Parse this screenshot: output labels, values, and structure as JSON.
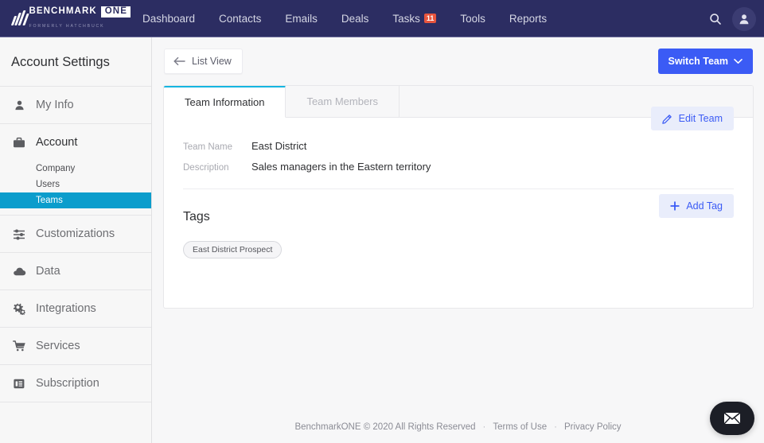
{
  "topnav": {
    "logo": {
      "brand": "BENCHMARK",
      "brand_mark": "ONE",
      "tagline": "FORMERLY HATCHBUCK",
      "icon": "benchmarkone-logo-icon"
    },
    "items": [
      {
        "label": "Dashboard"
      },
      {
        "label": "Contacts"
      },
      {
        "label": "Emails"
      },
      {
        "label": "Deals"
      },
      {
        "label": "Tasks",
        "badge": "11"
      },
      {
        "label": "Tools"
      },
      {
        "label": "Reports"
      }
    ],
    "search_icon": "search-icon",
    "account_icon": "user-account-icon",
    "bg_color": "#2c2d62",
    "badge_color": "#e8553e"
  },
  "sidebar": {
    "title": "Account Settings",
    "items": [
      {
        "label": "My Info",
        "icon": "person-icon"
      },
      {
        "label": "Account",
        "icon": "briefcase-icon"
      },
      {
        "label": "Customizations",
        "icon": "sliders-icon"
      },
      {
        "label": "Data",
        "icon": "cloud-icon"
      },
      {
        "label": "Integrations",
        "icon": "gears-icon"
      },
      {
        "label": "Services",
        "icon": "cart-icon"
      },
      {
        "label": "Subscription",
        "icon": "card-list-icon"
      }
    ],
    "account_subitems": [
      {
        "label": "Company",
        "active": false
      },
      {
        "label": "Users",
        "active": false
      },
      {
        "label": "Teams",
        "active": true
      }
    ],
    "active_color": "#0b9dcc"
  },
  "main": {
    "toolbar": {
      "list_view_label": "List View",
      "list_view_icon": "arrow-left-icon",
      "switch_team_label": "Switch Team",
      "switch_team_icon": "chevron-down-icon",
      "switch_team_color": "#3b5bf5"
    },
    "tabs": [
      {
        "label": "Team Information",
        "active": true
      },
      {
        "label": "Team Members",
        "active": false
      }
    ],
    "tab_accent_color": "#16b5e0",
    "fields": [
      {
        "label": "Team Name",
        "value": "East District"
      },
      {
        "label": "Description",
        "value": "Sales managers in the Eastern territory"
      }
    ],
    "edit_team": {
      "label": "Edit Team",
      "icon": "pencil-icon"
    },
    "tags_section": {
      "title": "Tags",
      "add_tag": {
        "label": "Add Tag",
        "icon": "plus-icon"
      },
      "tags": [
        {
          "label": "East District Prospect"
        }
      ]
    }
  },
  "footer": {
    "copyright": "BenchmarkONE © 2020 All Rights Reserved",
    "sep1": "·",
    "terms": "Terms of Use",
    "sep2": "·",
    "privacy": "Privacy Policy"
  },
  "chat": {
    "icon": "envelope-icon"
  }
}
